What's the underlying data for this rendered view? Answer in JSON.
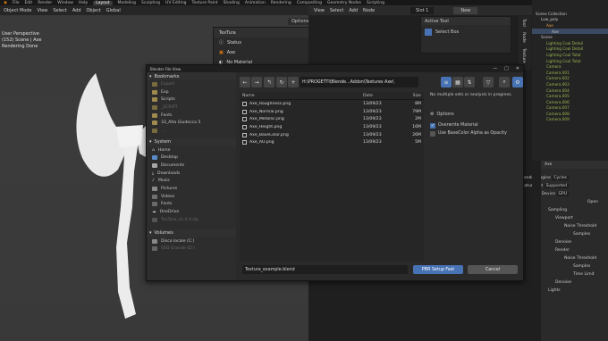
{
  "topbar": {
    "menus": [
      "File",
      "Edit",
      "Render",
      "Window",
      "Help"
    ],
    "workspaces": [
      "Layout",
      "Modeling",
      "Sculpting",
      "UV Editing",
      "Texture Paint",
      "Shading",
      "Animation",
      "Rendering",
      "Compositing",
      "Geometry Nodes",
      "Scripting"
    ],
    "active_workspace": "Layout",
    "scene": "Scene"
  },
  "viewport_header": {
    "mode": "Object Mode",
    "menus": [
      "View",
      "Select",
      "Add",
      "Object"
    ],
    "orientation": "Global",
    "options": "Options"
  },
  "viewport": {
    "lines": [
      "User Perspective",
      "(152) Scene | Axe",
      "Rendering Done"
    ]
  },
  "npanel": {
    "title": "TexTura",
    "rows": [
      "Status",
      "Axe",
      "No Material"
    ]
  },
  "node_editor_header": {
    "menus": [
      "View",
      "Select",
      "Add",
      "Node"
    ],
    "slot": "Slot 1",
    "new_label": "New"
  },
  "active_tool": {
    "title": "Active Tool",
    "tool": "Select Box"
  },
  "side_tabs": [
    "Tool",
    "Node",
    "Texture"
  ],
  "outliner": {
    "items": [
      "Scene Collection",
      "Low_poly",
      "Axe",
      "Axe",
      "Scene",
      "Lighting Cool Detail",
      "Lighting Cool Detail",
      "Lighting Cool Total",
      "Lighting Cool Total",
      "Camera",
      "Camera.001",
      "Camera.002",
      "Camera.003",
      "Camera.004",
      "Camera.005",
      "Camera.006",
      "Camera.007",
      "Camera.008",
      "Camera.009"
    ]
  },
  "properties": {
    "object": "Axe",
    "rows": [
      {
        "label": "Render Engine",
        "value": "Cycles"
      },
      {
        "label": "Feature Set",
        "value": "Supported"
      },
      {
        "label": "Device",
        "value": "GPU"
      },
      {
        "label": "",
        "value": "Open"
      },
      {
        "label": "Sampling",
        "value": ""
      },
      {
        "label": "Viewport",
        "value": ""
      },
      {
        "label": "Noise Threshold",
        "value": ""
      },
      {
        "label": "Samples",
        "value": ""
      },
      {
        "label": "Denoise",
        "value": ""
      },
      {
        "label": "Render",
        "value": ""
      },
      {
        "label": "Noise Threshold",
        "value": ""
      },
      {
        "label": "Samples",
        "value": ""
      },
      {
        "label": "Time Limit",
        "value": ""
      },
      {
        "label": "Denoise",
        "value": ""
      },
      {
        "label": "Lights",
        "value": ""
      }
    ]
  },
  "dialog": {
    "title": "Blender File View",
    "path": "H:\\PROGETTI\\Blende...Addon\\Textures Axe\\",
    "bookmarks_title": "Bookmarks",
    "bookmarks": [
      "Export",
      "Exp",
      "Scripts",
      "_SCRIPT",
      "Fonts",
      "33_Alta Giudecca 5",
      "..."
    ],
    "system_title": "System",
    "system": [
      "Home",
      "Desktop",
      "Documents",
      "Downloads",
      "Music",
      "Pictures",
      "Videos",
      "Fonts",
      "OneDrive",
      "TexTura_v1.0.4.zip"
    ],
    "volumes_title": "Volumes",
    "volumes": [
      "Disco locale (C:)",
      "SSD Grande (D:)"
    ],
    "columns": {
      "name": "Name",
      "date": "Date",
      "size": "Size"
    },
    "files": [
      {
        "name": "Axe_Roughness.png",
        "date": "13/09/23",
        "size": "8M"
      },
      {
        "name": "Axe_Normal.png",
        "date": "13/09/23",
        "size": "79M"
      },
      {
        "name": "Axe_Metallic.png",
        "date": "13/09/23",
        "size": "2M"
      },
      {
        "name": "Axe_Height.png",
        "date": "13/09/23",
        "size": "16M"
      },
      {
        "name": "Axe_BaseColor.png",
        "date": "13/09/23",
        "size": "26M"
      },
      {
        "name": "Axe_AO.png",
        "date": "13/09/23",
        "size": "5M"
      }
    ],
    "status": "No multiple sets or analysis in progress.",
    "options_title": "Options",
    "overwrite_label": "Overwrite Material",
    "overwrite_checked": true,
    "alpha_label": "Use BaseColor Alpha as Opacity",
    "alpha_checked": false,
    "filename": "Textura_example.blend",
    "ok_label": "PBR Setup Fast",
    "cancel_label": "Cancel"
  }
}
